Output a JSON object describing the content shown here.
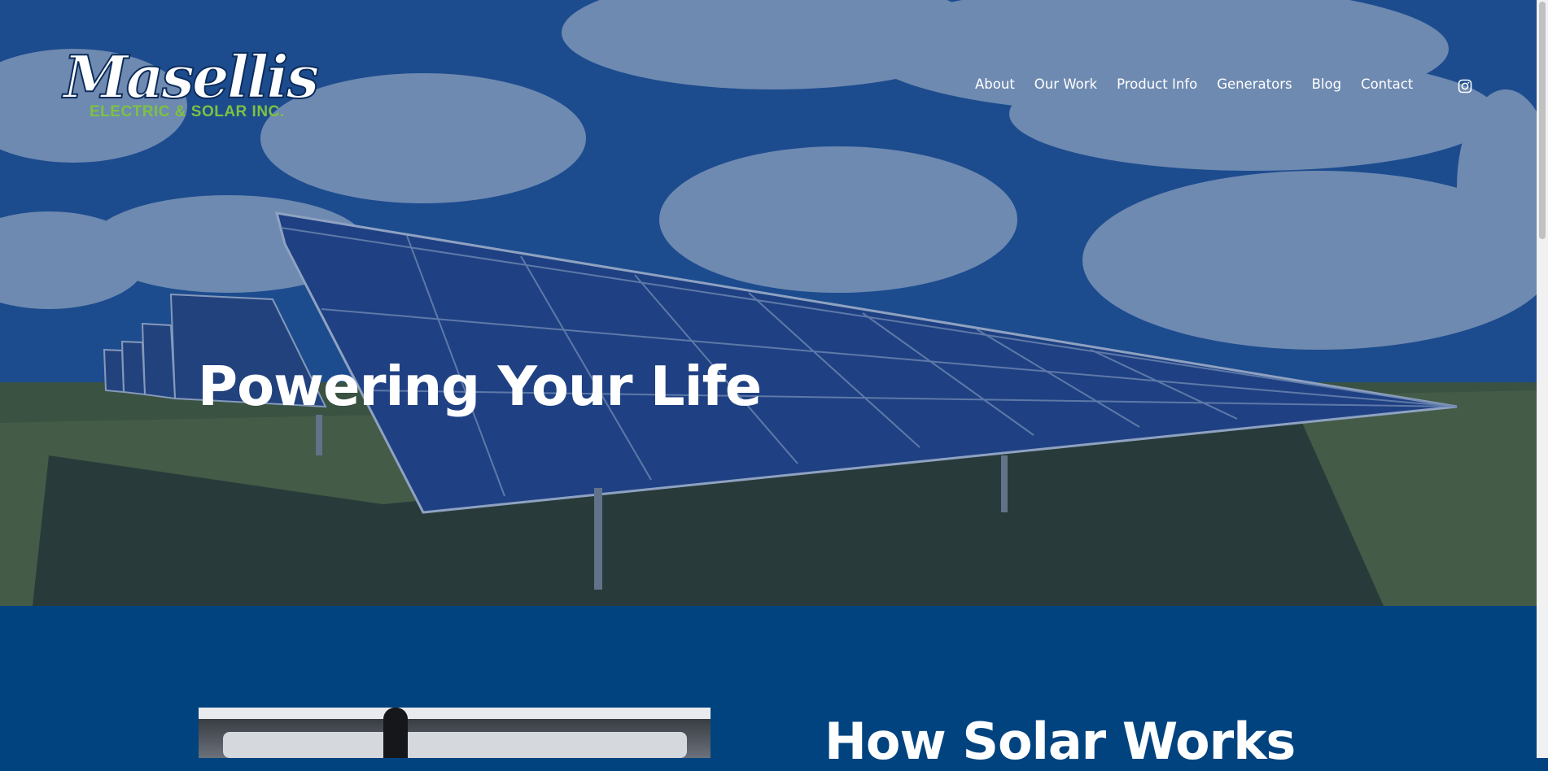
{
  "brand": {
    "name_script": "Masellis",
    "name_sub": "ELECTRIC & SOLAR INC.",
    "primary_color": "#01437f",
    "accent_green": "#7dc142"
  },
  "nav": {
    "items": [
      {
        "label": "About"
      },
      {
        "label": "Our Work"
      },
      {
        "label": "Product Info"
      },
      {
        "label": "Generators"
      },
      {
        "label": "Blog"
      },
      {
        "label": "Contact"
      }
    ],
    "social_icon": "instagram-icon"
  },
  "hero": {
    "title": "Powering Your Life"
  },
  "section": {
    "title": "How Solar Works"
  }
}
